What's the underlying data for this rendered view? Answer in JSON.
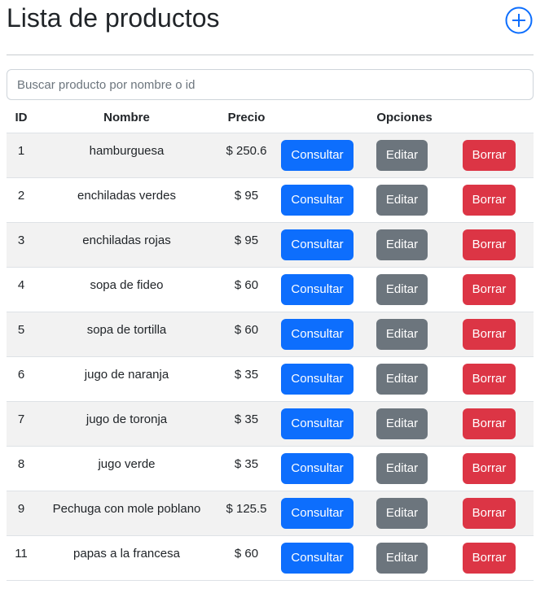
{
  "header": {
    "title": "Lista de productos",
    "add_icon": "plus-circle-icon"
  },
  "search": {
    "placeholder": "Buscar producto por nombre o id",
    "value": ""
  },
  "table": {
    "headers": {
      "id": "ID",
      "name": "Nombre",
      "price": "Precio",
      "options": "Opciones"
    },
    "actions": {
      "view": "Consultar",
      "edit": "Editar",
      "delete": "Borrar"
    },
    "rows": [
      {
        "id": "1",
        "name": "hamburguesa",
        "price": "$ 250.6"
      },
      {
        "id": "2",
        "name": "enchiladas verdes",
        "price": "$ 95"
      },
      {
        "id": "3",
        "name": "enchiladas rojas",
        "price": "$ 95"
      },
      {
        "id": "4",
        "name": "sopa de fideo",
        "price": "$ 60"
      },
      {
        "id": "5",
        "name": "sopa de tortilla",
        "price": "$ 60"
      },
      {
        "id": "6",
        "name": "jugo de naranja",
        "price": "$ 35"
      },
      {
        "id": "7",
        "name": "jugo de toronja",
        "price": "$ 35"
      },
      {
        "id": "8",
        "name": "jugo verde",
        "price": "$ 35"
      },
      {
        "id": "9",
        "name": "Pechuga con mole poblano",
        "price": "$ 125.5"
      },
      {
        "id": "11",
        "name": "papas a la francesa",
        "price": "$ 60"
      }
    ]
  },
  "colors": {
    "primary": "#0d6efd",
    "secondary": "#6c757d",
    "danger": "#dc3545",
    "stripe": "#f2f2f2"
  }
}
